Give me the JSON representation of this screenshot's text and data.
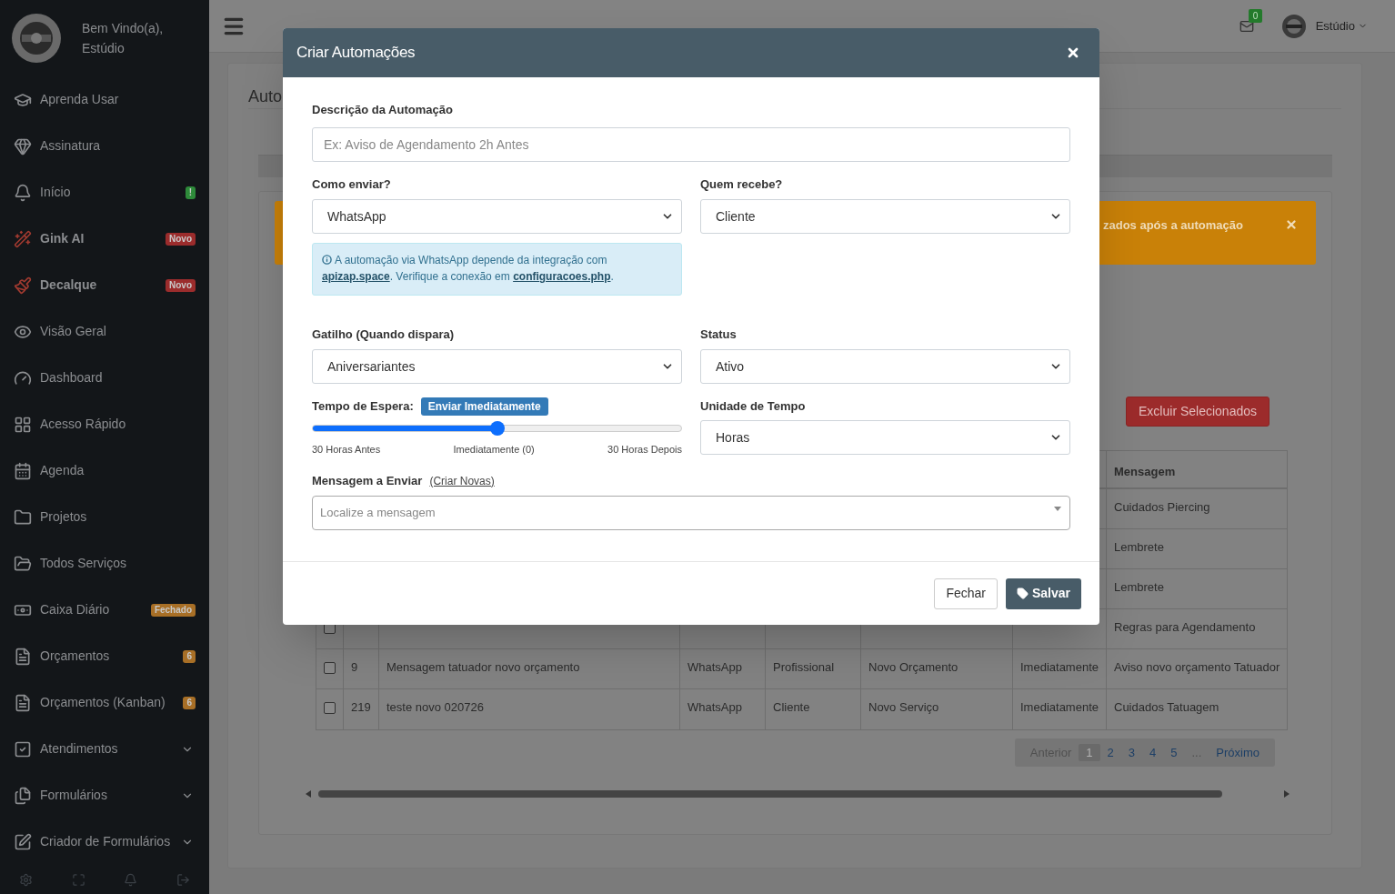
{
  "sidebar": {
    "greeting": "Bem Vindo(a),",
    "user": "Estúdio",
    "items": [
      {
        "label": "Aprenda Usar",
        "highlight": false,
        "expandable": false
      },
      {
        "label": "Assinatura",
        "highlight": false,
        "expandable": false
      },
      {
        "label": "Início",
        "highlight": false,
        "expandable": false,
        "badge": {
          "text": "!",
          "color": "#2e8b3a"
        }
      },
      {
        "label": "Gink AI",
        "highlight": true,
        "expandable": false,
        "badge": {
          "text": "Novo",
          "color": "#9b2c2c"
        }
      },
      {
        "label": "Decalque",
        "highlight": true,
        "expandable": false,
        "badge": {
          "text": "Novo",
          "color": "#9b2c2c"
        }
      },
      {
        "label": "Visão Geral",
        "highlight": false,
        "expandable": false
      },
      {
        "label": "Dashboard",
        "highlight": false,
        "expandable": false
      },
      {
        "label": "Acesso Rápido",
        "highlight": false,
        "expandable": false
      },
      {
        "label": "Agenda",
        "highlight": false,
        "expandable": false
      },
      {
        "label": "Projetos",
        "highlight": false,
        "expandable": false
      },
      {
        "label": "Todos Serviços",
        "highlight": false,
        "expandable": false
      },
      {
        "label": "Caixa Diário",
        "highlight": false,
        "expandable": false,
        "badge": {
          "text": "Fechado",
          "color": "#a86f26"
        }
      },
      {
        "label": "Orçamentos",
        "highlight": false,
        "expandable": false,
        "badge": {
          "text": "6",
          "color": "#a86f26"
        }
      },
      {
        "label": "Orçamentos (Kanban)",
        "highlight": false,
        "expandable": false,
        "badge": {
          "text": "6",
          "color": "#a86f26"
        }
      },
      {
        "label": "Atendimentos",
        "highlight": false,
        "expandable": true
      },
      {
        "label": "Formulários",
        "highlight": false,
        "expandable": true
      },
      {
        "label": "Criador de Formulários",
        "highlight": false,
        "expandable": true
      }
    ]
  },
  "topbar": {
    "mail_count": "0",
    "user": "Estúdio"
  },
  "page": {
    "title": "Auto",
    "alert": {
      "text": "zados após a automação"
    },
    "delete_button": "Excluir Selecionados",
    "table": {
      "message_column": "Mensagem",
      "rows": [
        {
          "message": "Cuidados Piercing"
        },
        {
          "message": "Lembrete"
        },
        {
          "message": "Lembrete"
        },
        {
          "checked": false,
          "message": "Regras para Agendamento"
        },
        {
          "checked": false,
          "id": "9",
          "description": "Mensagem tatuador novo orçamento",
          "channel": "WhatsApp",
          "recipient": "Profissional",
          "trigger": "Novo Orçamento",
          "wait": "Imediatamente",
          "message": "Aviso novo orçamento Tatuador"
        },
        {
          "checked": false,
          "id": "219",
          "description": "teste novo 020726",
          "channel": "WhatsApp",
          "recipient": "Cliente",
          "trigger": "Novo Serviço",
          "wait": "Imediatamente",
          "message": "Cuidados Tatuagem"
        }
      ]
    },
    "pagination": [
      {
        "label": "Anterior",
        "selected": false,
        "disabled": true
      },
      {
        "label": "1",
        "selected": true,
        "disabled": false
      },
      {
        "label": "2",
        "selected": false,
        "disabled": false
      },
      {
        "label": "3",
        "selected": false,
        "disabled": false
      },
      {
        "label": "4",
        "selected": false,
        "disabled": false
      },
      {
        "label": "5",
        "selected": false,
        "disabled": false
      },
      {
        "label": "...",
        "selected": false,
        "disabled": true
      },
      {
        "label": "Próximo",
        "selected": false,
        "disabled": false
      }
    ]
  },
  "modal": {
    "title": "Criar Automações",
    "description": {
      "label": "Descrição da Automação",
      "placeholder": "Ex: Aviso de Agendamento 2h Antes"
    },
    "channel": {
      "label": "Como enviar?",
      "value": "WhatsApp"
    },
    "recipient": {
      "label": "Quem recebe?",
      "value": "Cliente"
    },
    "info": [
      {
        "kind": "text",
        "text": "A automação via WhatsApp depende da integração com "
      },
      {
        "kind": "link",
        "text": "apizap.space"
      },
      {
        "kind": "text",
        "text": ". Verifique a conexão em "
      },
      {
        "kind": "link",
        "text": "configuracoes.php"
      },
      {
        "kind": "text",
        "text": "."
      }
    ],
    "trigger": {
      "label": "Gatilho (Quando dispara)",
      "value": "Aniversariantes"
    },
    "status": {
      "label": "Status",
      "value": "Ativo"
    },
    "wait": {
      "label": "Tempo de Espera:",
      "badge": "Enviar Imediatamente",
      "level": 0.5,
      "ticks": [
        "30 Horas Antes",
        "Imediatamente (0)",
        "30 Horas Depois"
      ]
    },
    "unit": {
      "label": "Unidade de Tempo",
      "value": "Horas"
    },
    "message": {
      "label": "Mensagem a Enviar",
      "link": "(Criar Novas)",
      "placeholder": "Localize a mensagem"
    },
    "buttons": {
      "close": "Fechar",
      "save": "Salvar"
    }
  }
}
